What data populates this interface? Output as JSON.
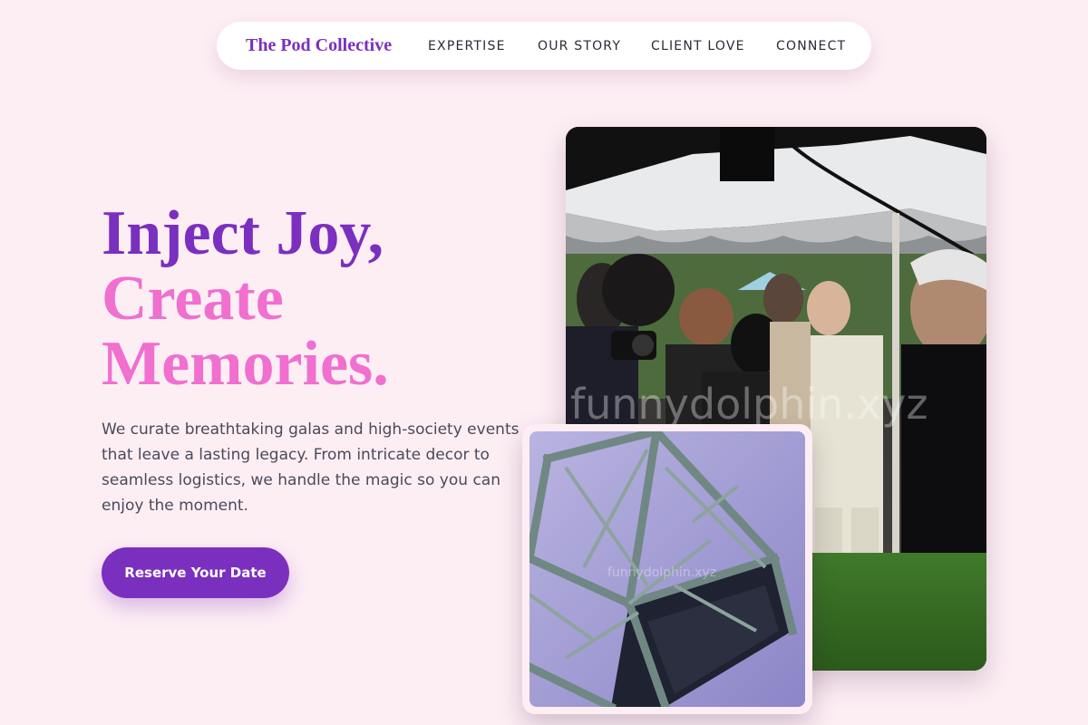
{
  "nav": {
    "brand": "The Pod Collective",
    "links": [
      {
        "label": "EXPERTISE"
      },
      {
        "label": "OUR STORY"
      },
      {
        "label": "CLIENT LOVE"
      },
      {
        "label": "CONNECT"
      }
    ]
  },
  "hero": {
    "headline_line1": "Inject Joy,",
    "headline_line2": "Create",
    "headline_line3": "Memories.",
    "description": "We curate breathtaking galas and high-society events that leave a lasting legacy. From intricate decor to seamless logistics, we handle the magic so you can enjoy the moment.",
    "cta_label": "Reserve Your Date"
  },
  "images": {
    "main_watermark": "funnydolphin.xyz",
    "small_watermark": "funnydolphin.xyz"
  },
  "colors": {
    "background": "#fdeef4",
    "primary": "#7b2fbe",
    "accent": "#f06fcf",
    "body_text": "#4a4a5a"
  }
}
